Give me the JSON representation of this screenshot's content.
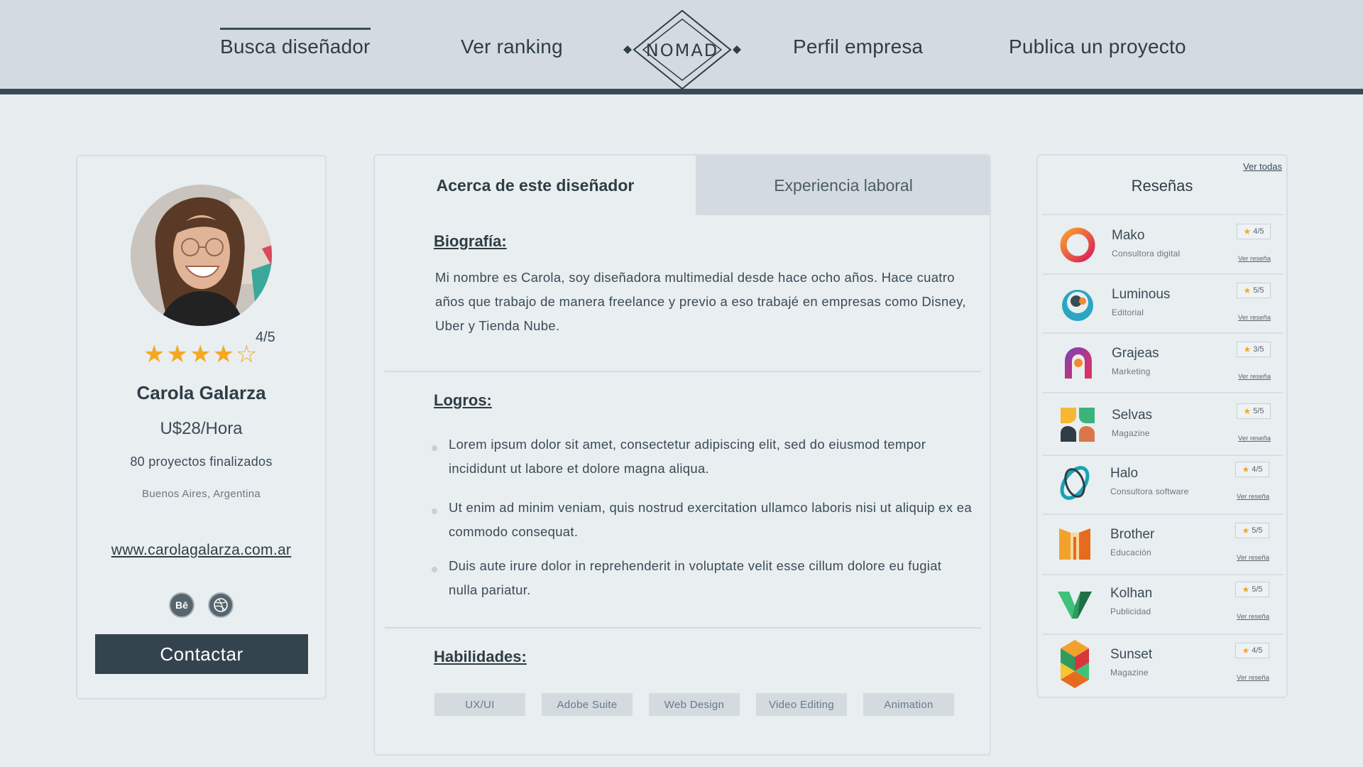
{
  "nav": {
    "items": [
      {
        "label": "Busca diseñador",
        "active": true
      },
      {
        "label": "Ver ranking",
        "active": false
      },
      {
        "label": "Perfil empresa",
        "active": false
      },
      {
        "label": "Publica un proyecto",
        "active": false
      }
    ],
    "logo_text": "NOMAD"
  },
  "profile": {
    "rating": 4,
    "rating_max": 5,
    "rating_label": "4/5",
    "name": "Carola Galarza",
    "rate": "U$28/Hora",
    "projects": "80 proyectos finalizados",
    "location": "Buenos Aires, Argentina",
    "website": "www.carolagalarza.com.ar",
    "social": [
      {
        "icon": "behance-icon",
        "label": "Bē"
      },
      {
        "icon": "dribbble-icon",
        "label": ""
      }
    ],
    "contact_label": "Contactar"
  },
  "tabs": {
    "about": "Acerca de este diseñador",
    "experience": "Experiencia laboral"
  },
  "about": {
    "bio_title": "Biografía:",
    "bio": "Mi nombre es Carola, soy diseñadora multimedial desde hace ocho años. Hace cuatro años que trabajo de manera freelance y previo a eso trabajé en empresas como Disney, Uber y Tienda Nube.",
    "achievements_title": "Logros:",
    "achievements": [
      "Lorem ipsum dolor sit amet, consectetur adipiscing elit, sed do eiusmod tempor incididunt ut labore et dolore magna aliqua.",
      "Ut enim ad minim veniam, quis nostrud exercitation ullamco laboris nisi ut aliquip ex ea commodo consequat.",
      "Duis aute irure dolor in reprehenderit in voluptate velit esse cillum dolore eu fugiat nulla pariatur."
    ],
    "skills_title": "Habilidades:",
    "skills": [
      "UX/UI",
      "Adobe Suite",
      "Web Design",
      "Video Editing",
      "Animation"
    ]
  },
  "reviews": {
    "title": "Reseñas",
    "see_all": "Ver todas",
    "link_label": "Ver reseña",
    "items": [
      {
        "name": "Mako",
        "sub": "Consultora digital",
        "score": "4/5",
        "logo": "mako-logo-icon"
      },
      {
        "name": "Luminous",
        "sub": "Editorial",
        "score": "5/5",
        "logo": "luminous-logo-icon"
      },
      {
        "name": "Grajeas",
        "sub": "Marketing",
        "score": "3/5",
        "logo": "grajeas-logo-icon"
      },
      {
        "name": "Selvas",
        "sub": "Magazine",
        "score": "5/5",
        "logo": "selvas-logo-icon"
      },
      {
        "name": "Halo",
        "sub": "Consultora software",
        "score": "4/5",
        "logo": "halo-logo-icon"
      },
      {
        "name": "Brother",
        "sub": "Educación",
        "score": "5/5",
        "logo": "brother-logo-icon"
      },
      {
        "name": "Kolhan",
        "sub": "Publicidad",
        "score": "5/5",
        "logo": "kolhan-logo-icon"
      },
      {
        "name": "Sunset",
        "sub": "Magazine",
        "score": "4/5",
        "logo": "sunset-logo-icon"
      }
    ]
  },
  "colors": {
    "accent": "#34444f",
    "star": "#f4a823",
    "nav_bg": "#d3dbe1",
    "page_bg": "#e8edf0"
  }
}
